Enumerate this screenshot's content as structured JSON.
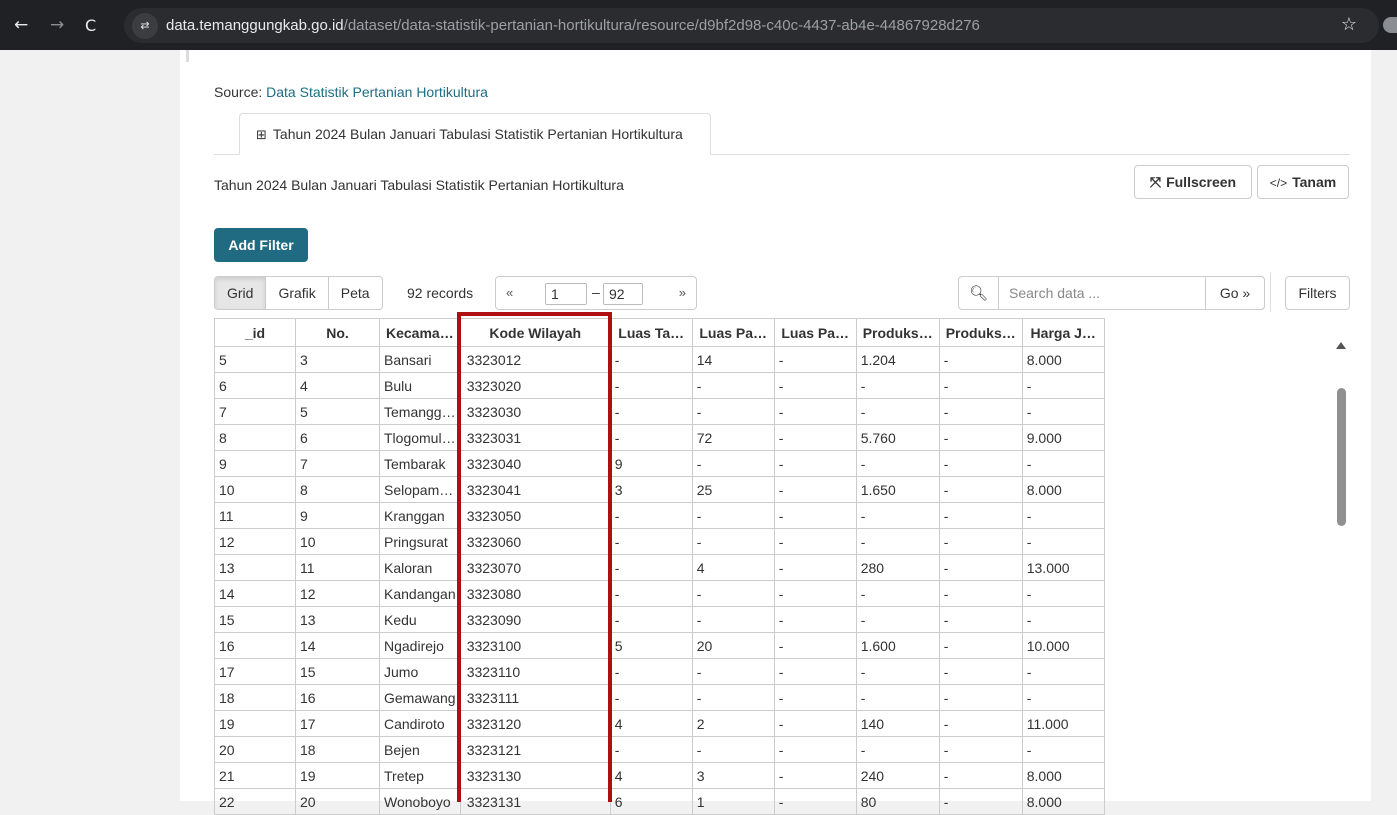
{
  "browser": {
    "back": "←",
    "forward": "→",
    "reload": "C",
    "site_info": "⇄",
    "url_domain": "data.temanggungkab.go.id",
    "url_path": "/dataset/data-statistik-pertanian-hortikultura/resource/d9bf2d98-c40c-4437-ab4e-44867928d276",
    "star": "☆"
  },
  "source": {
    "label": "Source:",
    "link": "Data Statistik Pertanian Hortikultura"
  },
  "view_tab": {
    "icon": "table-grid-icon",
    "label": "Tahun 2024 Bulan Januari Tabulasi Statistik Pertanian Hortikultura"
  },
  "view_title": "Tahun 2024 Bulan Januari Tabulasi Statistik Pertanian Hortikultura",
  "actions": {
    "fullscreen": "Fullscreen",
    "fullscreen_icon": "⤧",
    "embed": "Tanam",
    "embed_icon": "</>"
  },
  "add_filter": "Add Filter",
  "view_modes": [
    "Grid",
    "Grafik",
    "Peta"
  ],
  "active_view": "Grid",
  "records": "92 records",
  "pager": {
    "prev": "«",
    "next": "»",
    "from": "1",
    "dash": "–",
    "to": "92"
  },
  "search": {
    "placeholder": "Search data ...",
    "go": "Go »",
    "icon": "search-icon"
  },
  "filters": "Filters",
  "columns": [
    "_id",
    "No.",
    "Kecama…",
    "Kode Wilayah",
    "Luas Ta…",
    "Luas Pa…",
    "Luas Pa…",
    "Produks…",
    "Produks…",
    "Harga J…"
  ],
  "rows": [
    [
      "5",
      "3",
      "Bansari",
      "3323012",
      "-",
      "14",
      "-",
      "1.204",
      "-",
      "8.000"
    ],
    [
      "6",
      "4",
      "Bulu",
      "3323020",
      "-",
      "-",
      "-",
      "-",
      "-",
      "-"
    ],
    [
      "7",
      "5",
      "Temanggung",
      "3323030",
      "-",
      "-",
      "-",
      "-",
      "-",
      "-"
    ],
    [
      "8",
      "6",
      "Tlogomulyo",
      "3323031",
      "-",
      "72",
      "-",
      "5.760",
      "-",
      "9.000"
    ],
    [
      "9",
      "7",
      "Tembarak",
      "3323040",
      "9",
      "-",
      "-",
      "-",
      "-",
      "-"
    ],
    [
      "10",
      "8",
      "Selopampang",
      "3323041",
      "3",
      "25",
      "-",
      "1.650",
      "-",
      "8.000"
    ],
    [
      "11",
      "9",
      "Kranggan",
      "3323050",
      "-",
      "-",
      "-",
      "-",
      "-",
      "-"
    ],
    [
      "12",
      "10",
      "Pringsurat",
      "3323060",
      "-",
      "-",
      "-",
      "-",
      "-",
      "-"
    ],
    [
      "13",
      "11",
      "Kaloran",
      "3323070",
      "-",
      "4",
      "-",
      "280",
      "-",
      "13.000"
    ],
    [
      "14",
      "12",
      "Kandangan",
      "3323080",
      "-",
      "-",
      "-",
      "-",
      "-",
      "-"
    ],
    [
      "15",
      "13",
      "Kedu",
      "3323090",
      "-",
      "-",
      "-",
      "-",
      "-",
      "-"
    ],
    [
      "16",
      "14",
      "Ngadirejo",
      "3323100",
      "5",
      "20",
      "-",
      "1.600",
      "-",
      "10.000"
    ],
    [
      "17",
      "15",
      "Jumo",
      "3323110",
      "-",
      "-",
      "-",
      "-",
      "-",
      "-"
    ],
    [
      "18",
      "16",
      "Gemawang",
      "3323111",
      "-",
      "-",
      "-",
      "-",
      "-",
      "-"
    ],
    [
      "19",
      "17",
      "Candiroto",
      "3323120",
      "4",
      "2",
      "-",
      "140",
      "-",
      "11.000"
    ],
    [
      "20",
      "18",
      "Bejen",
      "3323121",
      "-",
      "-",
      "-",
      "-",
      "-",
      "-"
    ],
    [
      "21",
      "19",
      "Tretep",
      "3323130",
      "4",
      "3",
      "-",
      "240",
      "-",
      "8.000"
    ],
    [
      "22",
      "20",
      "Wonoboyo",
      "3323131",
      "6",
      "1",
      "-",
      "80",
      "-",
      "8.000"
    ]
  ],
  "colors": {
    "accent": "#206b82",
    "link": "#1f6d85",
    "highlight": "#b00f12"
  }
}
